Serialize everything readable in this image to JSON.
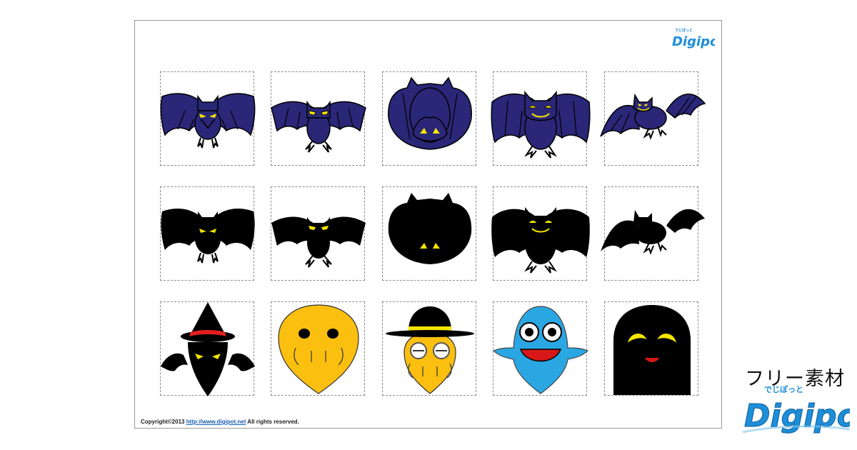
{
  "brand": {
    "logo_text": "Digipot",
    "logo_ruby": "でじぽっと",
    "free_label": "フリー素材"
  },
  "footer": {
    "copyright_prefix": "Copyright©2013 ",
    "url": "http://www.digipot.net",
    "copyright_suffix": " All rights reserved."
  },
  "colors": {
    "bat_fill": "#2a2778",
    "silhouette": "#000000",
    "eye_yellow": "#f5e600",
    "face_yellow": "#fbbf10",
    "face_blue": "#2aa7e3",
    "hat_band": "#e02020",
    "mouth_red": "#d81818",
    "logo_blue": "#1d8ed8"
  },
  "grid": {
    "rows": [
      [
        {
          "name": "bat-blue-spread-icon"
        },
        {
          "name": "bat-blue-angry-icon"
        },
        {
          "name": "bat-blue-hanging-icon"
        },
        {
          "name": "bat-blue-smiling-icon"
        },
        {
          "name": "bat-blue-flying-icon"
        }
      ],
      [
        {
          "name": "bat-silhouette-spread-icon"
        },
        {
          "name": "bat-silhouette-angry-icon"
        },
        {
          "name": "bat-silhouette-hanging-icon"
        },
        {
          "name": "bat-silhouette-smiling-icon"
        },
        {
          "name": "bat-silhouette-flying-icon"
        }
      ],
      [
        {
          "name": "witch-hat-ghost-icon"
        },
        {
          "name": "yellow-ghost-icon"
        },
        {
          "name": "bowler-hat-ghost-icon"
        },
        {
          "name": "blue-smiling-ghost-icon"
        },
        {
          "name": "black-ghost-icon"
        }
      ]
    ]
  }
}
